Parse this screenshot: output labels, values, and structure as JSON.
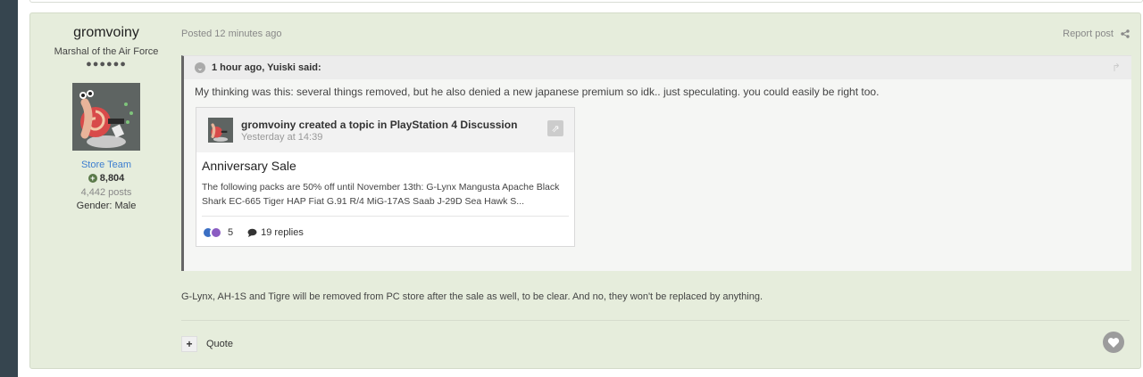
{
  "author": {
    "name": "gromvoiny",
    "rank": "Marshal of the Air Force",
    "pips": "●●●●●●",
    "group": "Store Team",
    "reputation": "8,804",
    "posts": "4,442 posts",
    "gender": "Gender: Male"
  },
  "post": {
    "meta": "Posted 12 minutes ago",
    "report_label": "Report post",
    "body": "G-Lynx, AH-1S and Tigre will be removed from PC store after the sale as well, to be clear. And no, they won't be replaced by anything.",
    "quote_label": "Quote"
  },
  "quote": {
    "header": "1 hour ago, Yuiski said:",
    "text": "My thinking was this: several things removed, but he also denied a new japanese premium so idk.. just speculating. you could easily be right too."
  },
  "embed": {
    "title": "gromvoiny created a topic in PlayStation 4 Discussion",
    "time": "Yesterday at 14:39",
    "topic": "Anniversary Sale",
    "snippet": "The following packs are 50% off until November 13th:   G-Lynx Mangusta Apache Black Shark EC-665 Tiger HAP Fiat G.91 R/4 MiG-17AS Saab J-29D Sea Hawk S...",
    "reaction_count": "5",
    "replies": "19 replies"
  },
  "colors": {
    "post_bg": "#e6eddc",
    "group_color": "#3d7ed0",
    "sidebar": "#36454f"
  }
}
